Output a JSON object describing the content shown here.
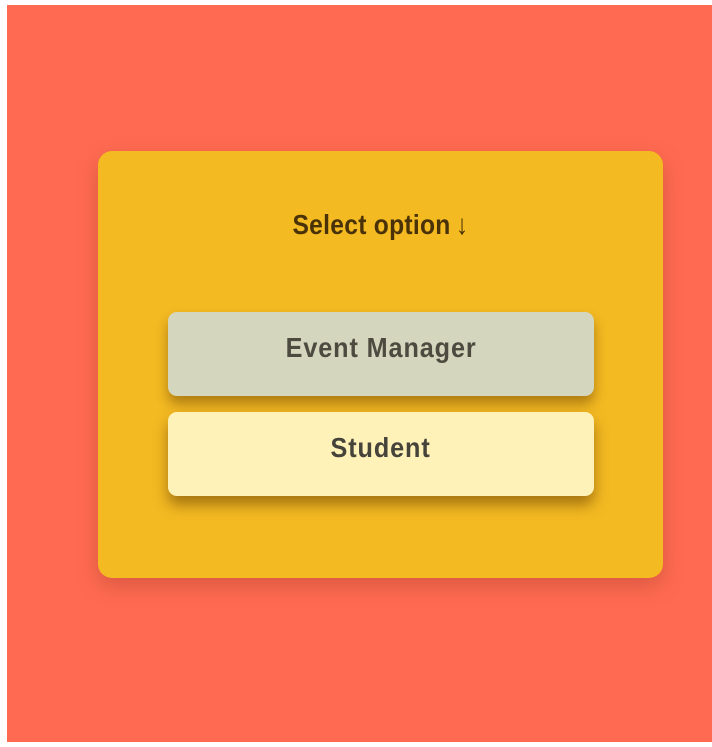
{
  "card": {
    "title": "Select option",
    "arrow": "↓"
  },
  "options": [
    {
      "label": "Event Manager"
    },
    {
      "label": "Student"
    }
  ],
  "colors": {
    "background": "#ff6b52",
    "card": "#f4ba22",
    "event_manager_button": "#d4d6bd",
    "student_button": "#fff2b8",
    "text": "#4a3208"
  }
}
